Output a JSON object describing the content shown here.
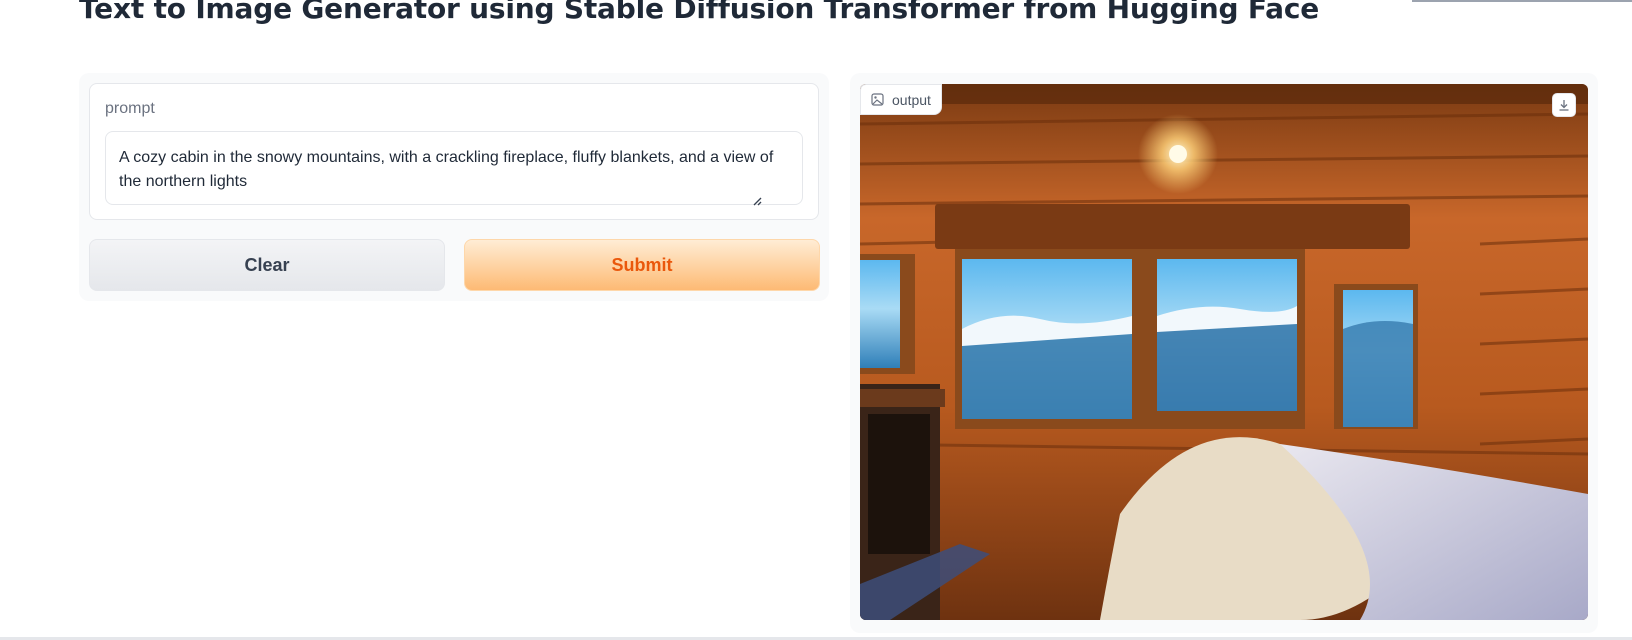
{
  "header": {
    "title": "Text to Image Generator using Stable Diffusion Transformer from Hugging Face"
  },
  "input": {
    "label": "prompt",
    "value": "A cozy cabin in the snowy mountains, with a crackling fireplace, fluffy blankets, and a view of the northern lights"
  },
  "actions": {
    "clear_label": "Clear",
    "submit_label": "Submit"
  },
  "output": {
    "label": "output",
    "image_icon": "image-icon",
    "download_icon": "download-icon"
  },
  "colors": {
    "submit_text": "#ea580c",
    "submit_bg_top": "#ffedd5",
    "submit_bg_bottom": "#fdba74",
    "clear_bg": "#e5e7eb"
  }
}
